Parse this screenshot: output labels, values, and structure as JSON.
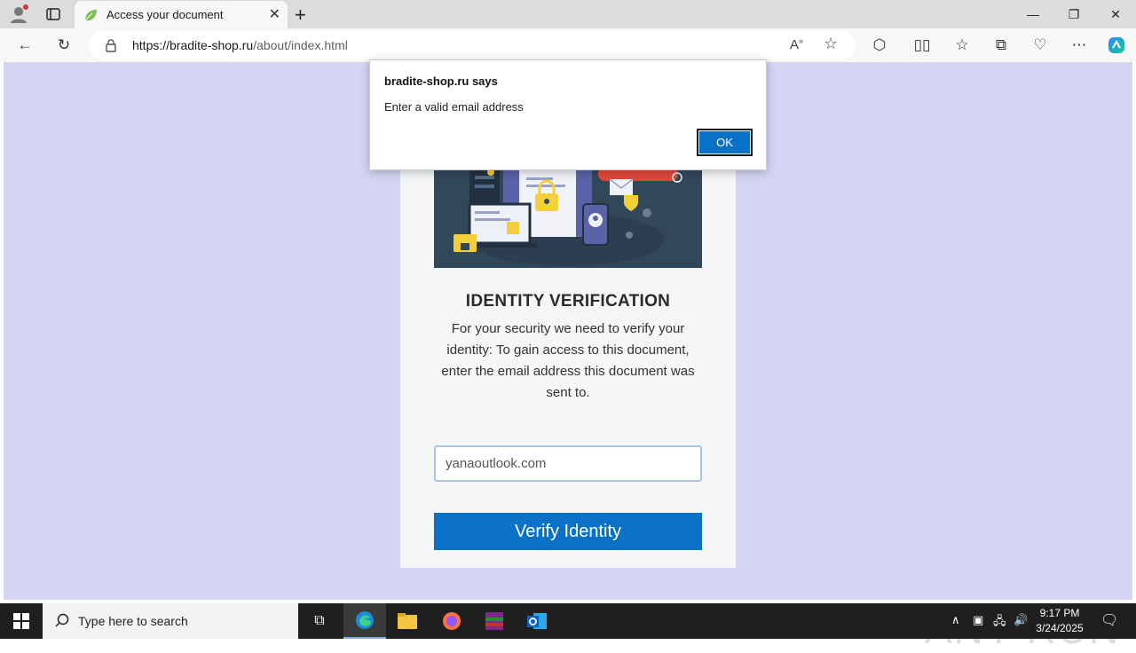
{
  "browser": {
    "tab_title": "Access your document",
    "url_host": "https://bradite-shop.ru",
    "url_path": "/about/index.html"
  },
  "page": {
    "heading": "IDENTITY VERIFICATION",
    "description": "For your security we need to verify your identity: To gain access to this document, enter the email address this document was sent to.",
    "email_value": "yanaoutlook.com",
    "verify_button": "Verify Identity"
  },
  "dialog": {
    "title": "bradite-shop.ru says",
    "message": "Enter a valid email address",
    "ok_label": "OK"
  },
  "watermark": "ANY RUN",
  "taskbar": {
    "search_placeholder": "Type here to search",
    "time": "9:17 PM",
    "date": "3/24/2025"
  },
  "colors": {
    "page_background": "#d3d5f3",
    "accent_blue": "#0a72c6",
    "illustration_bg": "#33475b"
  }
}
